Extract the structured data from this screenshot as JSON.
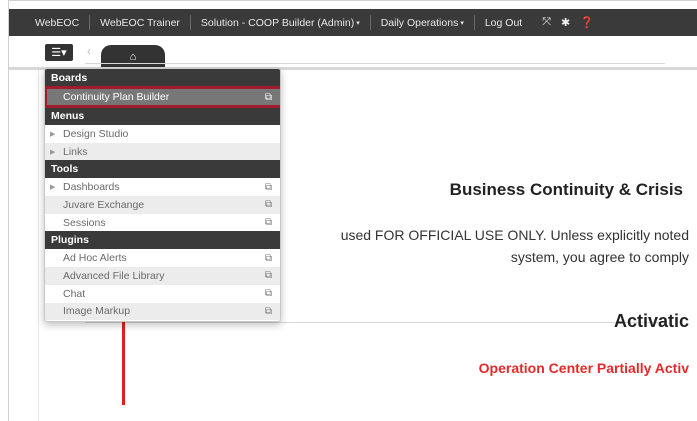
{
  "topbar": {
    "items": [
      {
        "label": "WebEOC",
        "caret": ""
      },
      {
        "label": "WebEOC Trainer",
        "caret": ""
      },
      {
        "label": "Solution - COOP Builder (Admin)",
        "caret": "▾"
      },
      {
        "label": "Daily Operations",
        "caret": "▾"
      },
      {
        "label": "Log Out",
        "caret": ""
      }
    ],
    "icons": [
      {
        "name": "expand-icon",
        "glyph": "⤧"
      },
      {
        "name": "gear-icon",
        "glyph": "✱"
      },
      {
        "name": "help-icon",
        "glyph": "❓"
      }
    ]
  },
  "toolbar": {
    "menu_glyph": "☰▾",
    "back_glyph": "‹",
    "home_glyph": "⌂"
  },
  "dropdown": {
    "sections": [
      {
        "header": "Boards",
        "items": [
          {
            "label": "Continuity Plan Builder",
            "external": true,
            "arrow": false,
            "selected": true
          }
        ]
      },
      {
        "header": "Menus",
        "items": [
          {
            "label": "Design Studio",
            "external": false,
            "arrow": true,
            "selected": false
          },
          {
            "label": "Links",
            "external": false,
            "arrow": true,
            "selected": false
          }
        ]
      },
      {
        "header": "Tools",
        "items": [
          {
            "label": "Dashboards",
            "external": true,
            "arrow": true,
            "selected": false
          },
          {
            "label": "Juvare Exchange",
            "external": true,
            "arrow": false,
            "selected": false
          },
          {
            "label": "Sessions",
            "external": true,
            "arrow": false,
            "selected": false
          }
        ]
      },
      {
        "header": "Plugins",
        "items": [
          {
            "label": "Ad Hoc Alerts",
            "external": true,
            "arrow": false,
            "selected": false
          },
          {
            "label": "Advanced File Library",
            "external": true,
            "arrow": false,
            "selected": false
          },
          {
            "label": "Chat",
            "external": true,
            "arrow": false,
            "selected": false
          },
          {
            "label": "Image Markup",
            "external": true,
            "arrow": false,
            "selected": false
          }
        ]
      }
    ],
    "external_glyph": "⧉",
    "arrow_glyph": "▶"
  },
  "main": {
    "heading": "Business Continuity & Crisis",
    "notice_line1": "used FOR OFFICIAL USE ONLY. Unless explicitly noted",
    "notice_line2": "system, you agree to comply",
    "activation_title": "Activatic",
    "status_text": "Operation Center Partially Activ"
  },
  "colors": {
    "topbar_bg": "#3a3a3a",
    "status_red": "#e32a2a",
    "selection_border": "#a01c2c",
    "selected_row_bg": "#777777"
  }
}
